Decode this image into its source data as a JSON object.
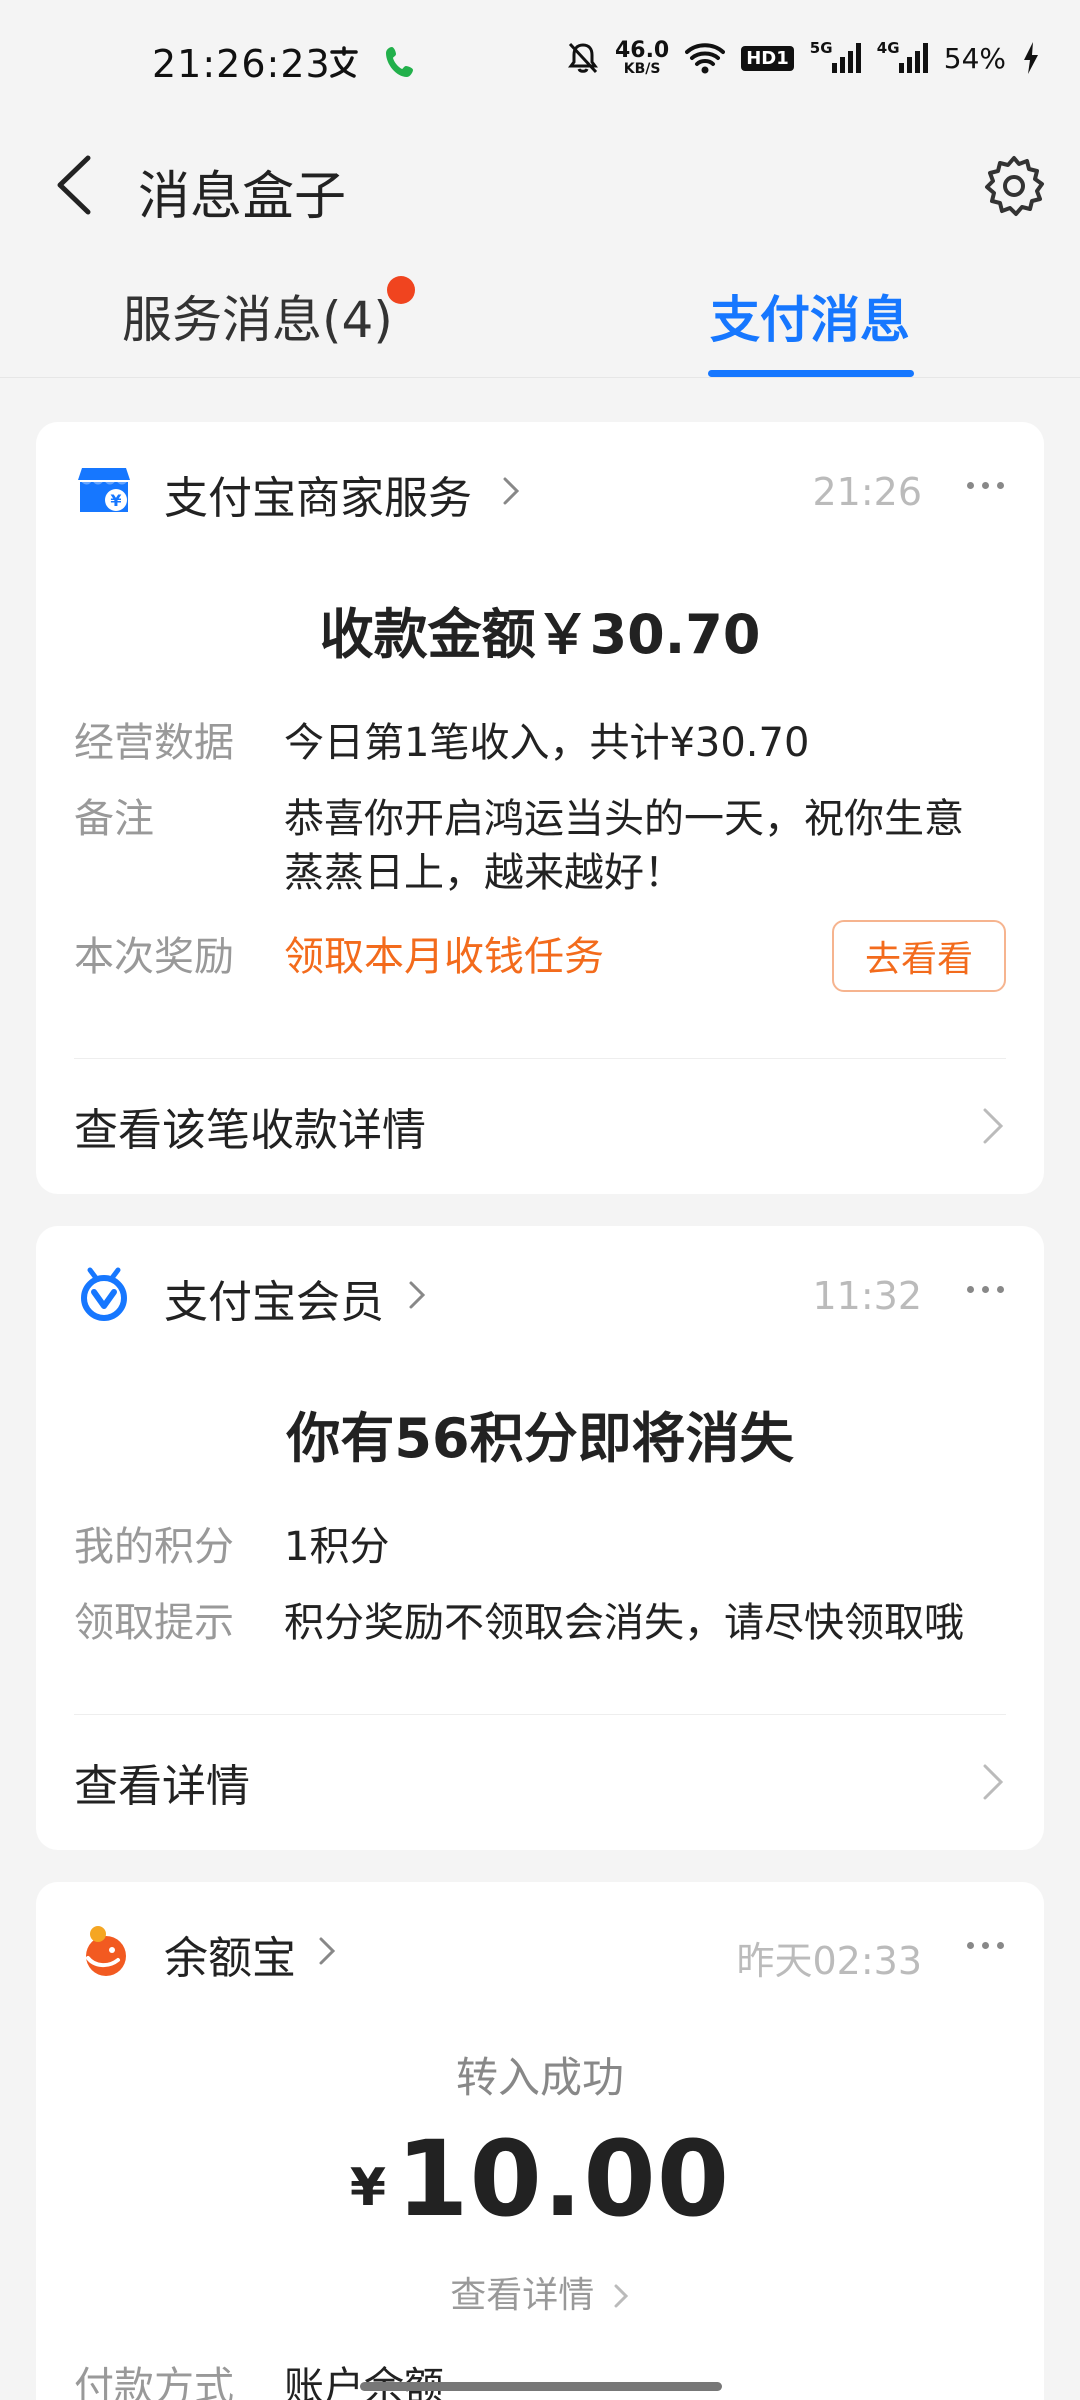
{
  "status_bar": {
    "time": "21:26:23",
    "net_speed": "46.0",
    "net_unit": "KB/S",
    "hd_label": "HD1",
    "sig1_label": "5G",
    "sig2_label": "4G",
    "battery": "54%"
  },
  "header": {
    "title": "消息盒子"
  },
  "tabs": {
    "service": "服务消息(4)",
    "pay": "支付消息",
    "active": "pay"
  },
  "cards": [
    {
      "name": "支付宝商家服务",
      "time": "21:26",
      "headline": "收款金额￥30.70",
      "rows": [
        {
          "label": "经营数据",
          "value": "今日第1笔收入，共计¥30.70"
        },
        {
          "label": "备注",
          "value_line1": "恭喜你开启鸿运当头的一天，祝你生意",
          "value_line2": "蒸蒸日上，越来越好！"
        },
        {
          "label": "本次奖励",
          "value": "领取本月收钱任务",
          "button": "去看看"
        }
      ],
      "footer_link": "查看该笔收款详情",
      "brand_color": "#1677ff"
    },
    {
      "name": "支付宝会员",
      "time": "11:32",
      "headline": "你有56积分即将消失",
      "rows": [
        {
          "label": "我的积分",
          "value": "1积分"
        },
        {
          "label": "领取提示",
          "value": "积分奖励不领取会消失，请尽快领取哦"
        }
      ],
      "footer_link": "查看详情",
      "brand_color": "#1677ff"
    },
    {
      "name": "余额宝",
      "time": "昨天02:33",
      "status": "转入成功",
      "currency": "¥",
      "amount": "10.00",
      "detail_link": "查看详情",
      "rows": [
        {
          "label": "付款方式",
          "value": "账户余额"
        }
      ],
      "brand_color": "#f25a21"
    }
  ],
  "colors": {
    "accent": "#1677ff",
    "badge": "#f0441f",
    "reward": "#f36b1c"
  }
}
